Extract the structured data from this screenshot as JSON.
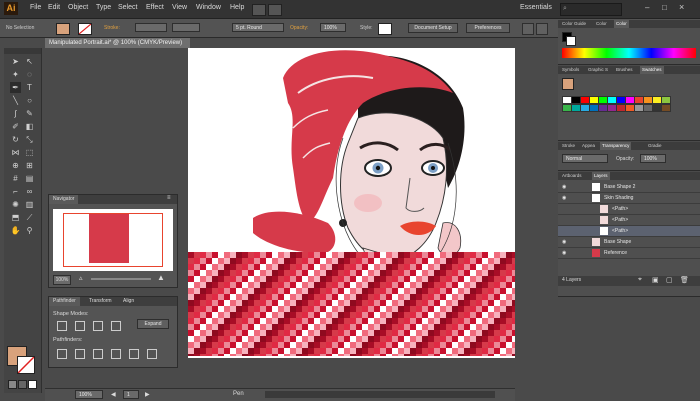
{
  "app": {
    "logo": "Ai",
    "workspace": "Essentials"
  },
  "menus": [
    "File",
    "Edit",
    "Object",
    "Type",
    "Select",
    "Effect",
    "View",
    "Window",
    "Help"
  ],
  "control": {
    "selection_label": "No Selection",
    "stroke_label": "Stroke:",
    "brush_value": "5 pt. Round",
    "opacity_label": "Opacity:",
    "opacity_value": "100%",
    "style_label": "Style:",
    "doc_setup": "Document Setup",
    "preferences": "Preferences"
  },
  "document": {
    "tab": "Manipulated Portrait.ai* @ 100% (CMYK/Preview)"
  },
  "navigator": {
    "tab": "Navigator",
    "zoom": "100%"
  },
  "pathfinder": {
    "tabs": [
      "Pathfinder",
      "Transform",
      "Align"
    ],
    "shape_modes": "Shape Modes:",
    "pathfinders": "Pathfinders:",
    "expand": "Expand"
  },
  "color_panel": {
    "tabs": [
      "Color Guide",
      "Color",
      "Color"
    ]
  },
  "swatch_panel": {
    "tabs": [
      "Symbols",
      "Graphic S",
      "Brushes",
      "Swatches"
    ]
  },
  "transparency": {
    "tabs": [
      "Stroke",
      "Appea",
      "Transparency",
      "Gradie"
    ],
    "mode": "Normal",
    "opacity_label": "Opacity:",
    "opacity_value": "100%"
  },
  "layers": {
    "tabs": [
      "Artboards",
      "Layers"
    ],
    "rows": [
      "Base Shape 2",
      "Skin Shading",
      "<Path>",
      "<Path>",
      "<Path>",
      "Base Shape",
      "Reference"
    ],
    "count": "4 Layers"
  },
  "status": {
    "zoom": "100%",
    "page": "1",
    "tool": "Pen"
  },
  "colors": {
    "fill": "#d8a27c",
    "accent": "#e8442e",
    "bandana": "#d63a4a"
  }
}
